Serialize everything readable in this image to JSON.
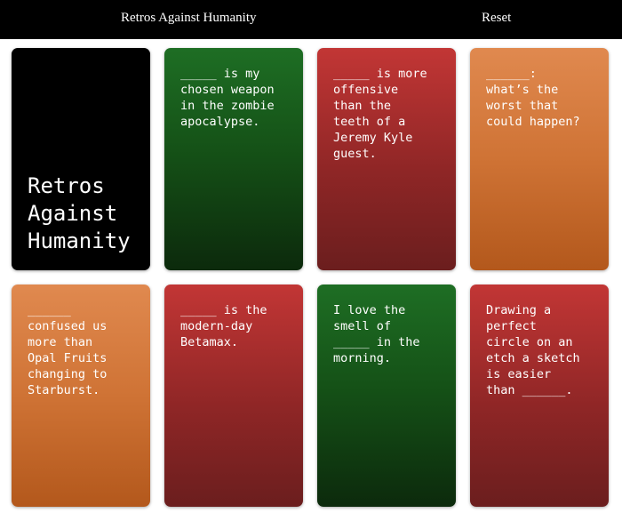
{
  "header": {
    "title": "Retros Against Humanity",
    "reset_label": "Reset"
  },
  "cards": [
    {
      "text": "Retros\nAgainst\nHumanity",
      "color": "black"
    },
    {
      "text": "_____ is my\nchosen weapon\nin the zombie\napocalypse.",
      "color": "green"
    },
    {
      "text": "_____ is more\noffensive\nthan the\nteeth of a\nJeremy Kyle\nguest.",
      "color": "red"
    },
    {
      "text": "______:\nwhat’s the\nworst that\ncould happen?",
      "color": "orange"
    },
    {
      "text": "______\nconfused us\nmore than\nOpal Fruits\nchanging to\nStarburst.",
      "color": "orange"
    },
    {
      "text": "_____ is the\nmodern-day\nBetamax.",
      "color": "red"
    },
    {
      "text": "I love the\nsmell of\n_____ in the\nmorning.",
      "color": "green"
    },
    {
      "text": "Drawing a\nperfect\ncircle on an\netch a sketch\nis easier\nthan ______.",
      "color": "red"
    }
  ],
  "colors": {
    "black": "#000000",
    "green": "#1e6e24",
    "red": "#c23635",
    "orange": "#e0894f"
  }
}
